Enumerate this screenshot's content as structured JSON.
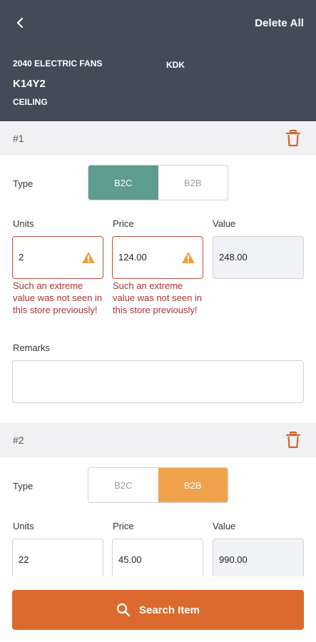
{
  "header": {
    "delete_all": "Delete All",
    "category": "2040 ELECTRIC FANS",
    "brand": "KDK",
    "model": "K14Y2",
    "subtype": "CEILING"
  },
  "items": [
    {
      "number": "#1",
      "type_label": "Type",
      "options": [
        "B2C",
        "B2B"
      ],
      "selected": "B2C",
      "units_label": "Units",
      "price_label": "Price",
      "value_label": "Value",
      "units": "2",
      "price": "124.00",
      "value": "248.00",
      "units_error": "Such an extreme value was not seen in this store previously!",
      "price_error": "Such an extreme value was not seen in this store previously!",
      "remarks_label": "Remarks",
      "remarks": ""
    },
    {
      "number": "#2",
      "type_label": "Type",
      "options": [
        "B2C",
        "B2B"
      ],
      "selected": "B2B",
      "units_label": "Units",
      "price_label": "Price",
      "value_label": "Value",
      "units": "22",
      "price": "45.00",
      "value": "990.00"
    }
  ],
  "search_button": "Search Item",
  "colors": {
    "header_bg": "#444b57",
    "teal": "#5e9c8f",
    "orange_toggle": "#f0a24a",
    "search_button": "#dc6a2f",
    "error_text": "#a83232",
    "warning": "#e8a33c",
    "trash": "#d9612a"
  },
  "icons": [
    "back-arrow-icon",
    "trash-icon",
    "warning-icon",
    "search-icon"
  ]
}
